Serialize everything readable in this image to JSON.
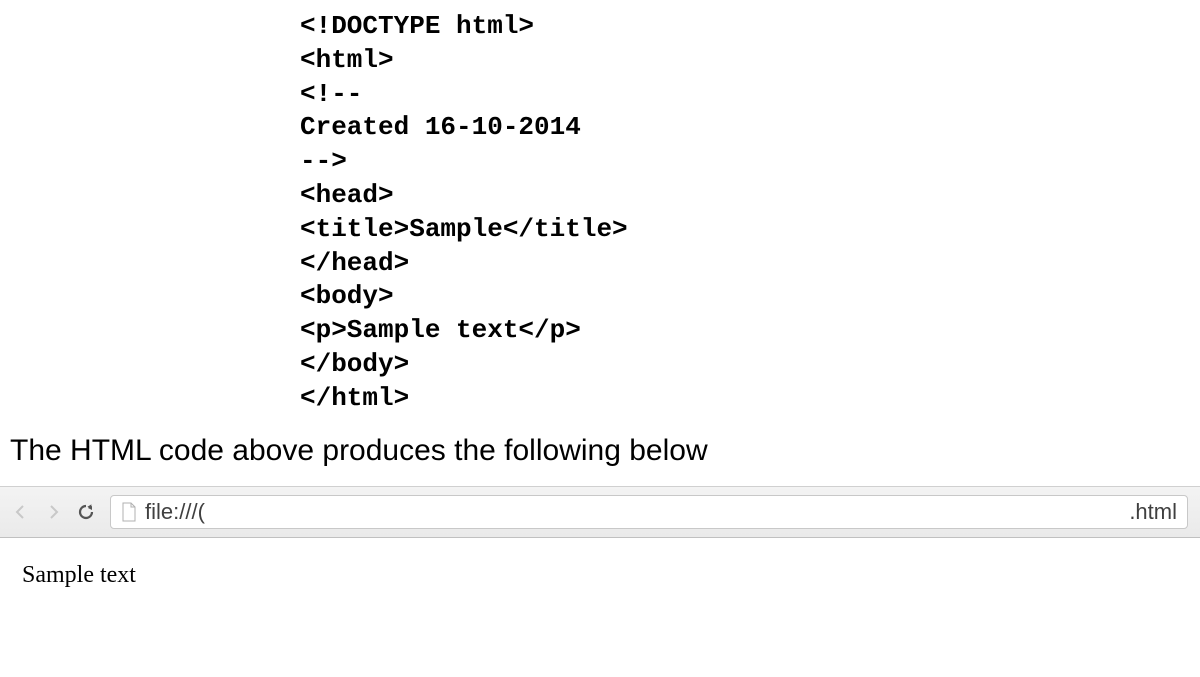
{
  "code": {
    "line1": "<!DOCTYPE html>",
    "line2": "<html>",
    "line3": "<!--",
    "line4": "Created 16-10-2014",
    "line5": "-->",
    "line6": "<head>",
    "line7": "<title>Sample</title>",
    "line8": "</head>",
    "line9": "<body>",
    "line10": "<p>Sample text</p>",
    "line11": "</body>",
    "line12": "</html>"
  },
  "caption": "The HTML code above produces the following below",
  "browser": {
    "url_prefix": "file:///(",
    "url_suffix": ".html"
  },
  "page": {
    "output_text": "Sample text"
  }
}
